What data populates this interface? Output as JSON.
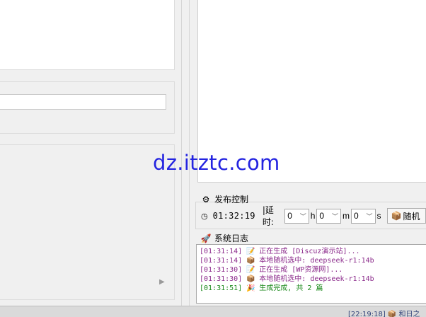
{
  "publish_control": {
    "title": "发布控制",
    "current_time": "01:32:19",
    "delay_label": "|延时:",
    "hours_value": "0",
    "hours_unit": "h",
    "minutes_value": "0",
    "minutes_unit": "m",
    "seconds_value": "0",
    "seconds_unit": "s",
    "random_button_label": "随机"
  },
  "system_log": {
    "title": "系统日志",
    "entries": [
      {
        "time": "[01:31:14]",
        "icon": "pencil-icon",
        "glyph": "📝",
        "text": "正在生成 [Discuz演示站]...",
        "color": "#8b2a8b"
      },
      {
        "time": "[01:31:14]",
        "icon": "box-icon",
        "glyph": "📦",
        "text": "本地随机选中: deepseek-r1:14b",
        "color": "#8b2a8b"
      },
      {
        "time": "[01:31:30]",
        "icon": "pencil-icon",
        "glyph": "📝",
        "text": "正在生成 [WP资源网]...",
        "color": "#8b2a8b"
      },
      {
        "time": "[01:31:30]",
        "icon": "box-icon",
        "glyph": "📦",
        "text": "本地随机选中: deepseek-r1:14b",
        "color": "#8b2a8b"
      },
      {
        "time": "[01:31:51]",
        "icon": "party-icon",
        "glyph": "🎉",
        "text": "生成完成, 共 2 篇",
        "color": "#1c8a1c"
      }
    ]
  },
  "watermark": "dz.itztc.com",
  "taskbar": {
    "partial_text": "[22:19:18] 📦 和日之"
  }
}
